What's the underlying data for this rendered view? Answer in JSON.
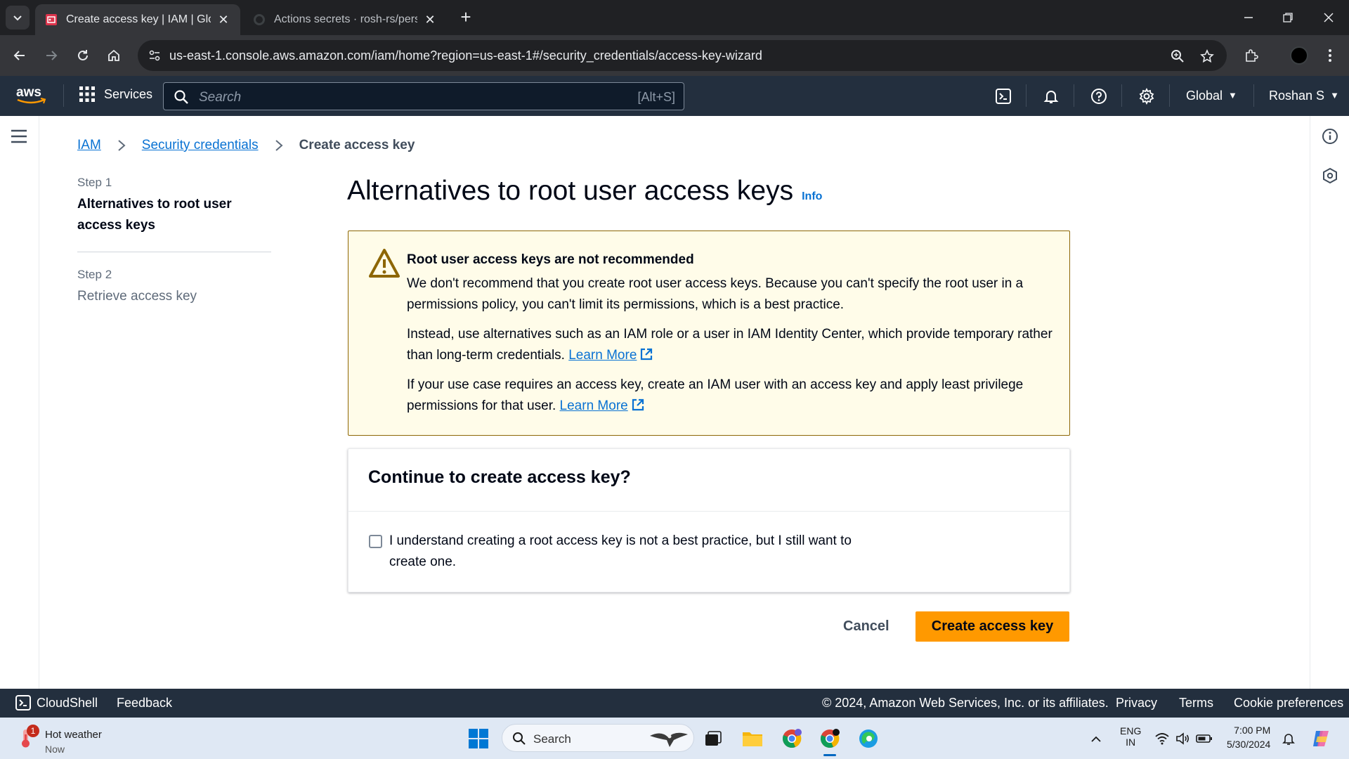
{
  "browser": {
    "tabs": [
      {
        "title": "Create access key | IAM | Global",
        "active": true
      },
      {
        "title": "Actions secrets · rosh-rs/person",
        "active": false
      }
    ],
    "url": "us-east-1.console.aws.amazon.com/iam/home?region=us-east-1#/security_credentials/access-key-wizard"
  },
  "aws_nav": {
    "logo_text": "aws",
    "services_label": "Services",
    "search_placeholder": "Search",
    "search_shortcut": "[Alt+S]",
    "region_label": "Global",
    "user_label": "Roshan S"
  },
  "breadcrumb": {
    "items": [
      "IAM",
      "Security credentials"
    ],
    "current": "Create access key"
  },
  "steps": [
    {
      "number": "Step 1",
      "title": "Alternatives to root user access keys"
    },
    {
      "number": "Step 2",
      "title": "Retrieve access key"
    }
  ],
  "page": {
    "title": "Alternatives to root user access keys",
    "info_link": "Info"
  },
  "alert": {
    "heading": "Root user access keys are not recommended",
    "para1": "We don't recommend that you create root user access keys. Because you can't specify the root user in a permissions policy, you can't limit its permissions, which is a best practice.",
    "para2": "Instead, use alternatives such as an IAM role or a user in IAM Identity Center, which provide temporary rather than long-term credentials.",
    "para3": "If your use case requires an access key, create an IAM user with an access key and apply least privilege permissions for that user.",
    "learn_more": "Learn More"
  },
  "confirm": {
    "heading": "Continue to create access key?",
    "checkbox_label": "I understand creating a root access key is not a best practice, but I still want to create one.",
    "checked": false
  },
  "actions": {
    "cancel": "Cancel",
    "create": "Create access key"
  },
  "footer": {
    "cloudshell": "CloudShell",
    "feedback": "Feedback",
    "copyright": "© 2024, Amazon Web Services, Inc. or its affiliates.",
    "privacy": "Privacy",
    "terms": "Terms",
    "cookie": "Cookie preferences"
  },
  "taskbar": {
    "weather_title": "Hot weather",
    "weather_sub": "Now",
    "weather_badge": "1",
    "search_placeholder": "Search",
    "lang_top": "ENG",
    "lang_bottom": "IN",
    "time": "7:00 PM",
    "date": "5/30/2024"
  },
  "colors": {
    "aws_nav": "#232f3e",
    "link": "#0972d3",
    "primary_button": "#ff9900",
    "warning_bg": "#fffce9",
    "warning_border": "#8d6605"
  }
}
